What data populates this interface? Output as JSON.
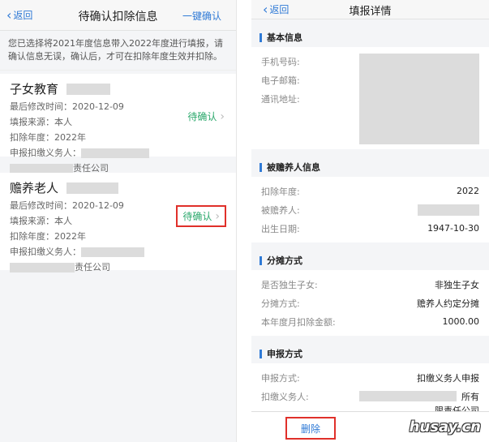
{
  "left": {
    "nav": {
      "back": "返回",
      "title": "待确认扣除信息",
      "action": "一键确认"
    },
    "notice": "您已选择将2021年度信息带入2022年度进行填报，请确认信息无误，确认后，才可在扣除年度生效并扣除。",
    "cards": [
      {
        "title": "子女教育",
        "modified": "最后修改时间：2020-12-09",
        "source": "填报来源：本人",
        "year": "扣除年度：2022年",
        "agent_label": "申报扣缴义务人：",
        "company_suffix": "责任公司",
        "status": "待确认"
      },
      {
        "title": "赡养老人",
        "modified": "最后修改时间：2020-12-09",
        "source": "填报来源：本人",
        "year": "扣除年度：2022年",
        "agent_label": "申报扣缴义务人：",
        "company_suffix": "责任公司",
        "status": "待确认"
      }
    ]
  },
  "right": {
    "nav": {
      "back": "返回",
      "title": "填报详情"
    },
    "sections": {
      "basic": {
        "title": "基本信息",
        "phone": "手机号码:",
        "email": "电子邮箱:",
        "address": "通讯地址:"
      },
      "supported": {
        "title": "被赡养人信息",
        "year_k": "扣除年度:",
        "year_v": "2022",
        "name_k": "被赡养人:",
        "birth_k": "出生日期:",
        "birth_v": "1947-10-30"
      },
      "split": {
        "title": "分摊方式",
        "only_k": "是否独生子女:",
        "only_v": "非独生子女",
        "way_k": "分摊方式:",
        "way_v": "赡养人约定分摊",
        "amount_k": "本年度月扣除金额:",
        "amount_v": "1000.00"
      },
      "declare": {
        "title": "申报方式",
        "method_k": "申报方式:",
        "method_v": "扣缴义务人申报",
        "agent_k": "扣缴义务人:",
        "agent_v1": "所有",
        "agent_v2": "限责任公司"
      }
    },
    "delete": "删除"
  },
  "watermark": "husay.cn"
}
